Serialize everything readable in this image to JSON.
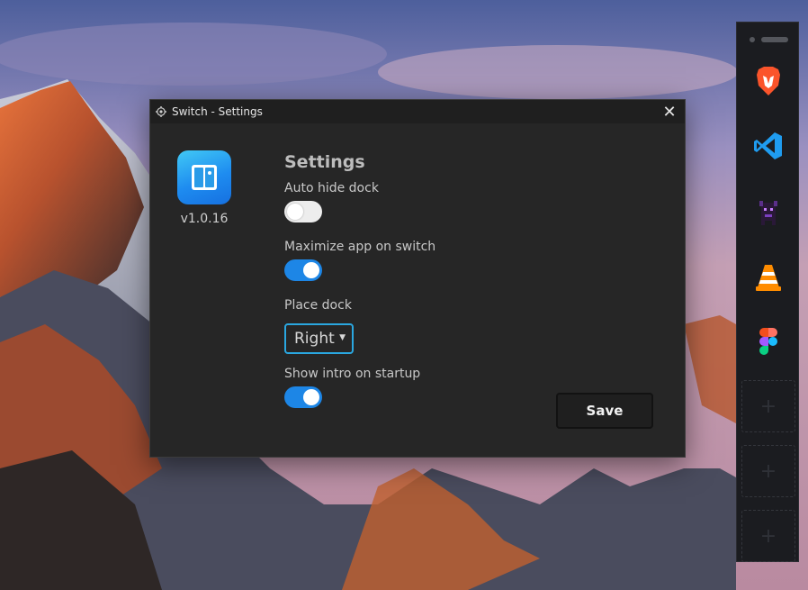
{
  "window": {
    "title": "Switch - Settings",
    "close_glyph": "✕",
    "version": "v1.0.16"
  },
  "settings": {
    "heading": "Settings",
    "auto_hide_dock": {
      "label": "Auto hide dock",
      "enabled": false
    },
    "maximize_app": {
      "label": "Maximize app on switch",
      "enabled": true
    },
    "place_dock": {
      "label": "Place dock",
      "value": "Right",
      "caret": "▼"
    },
    "show_intro": {
      "label": "Show intro on startup",
      "enabled": true
    },
    "save_label": "Save"
  },
  "dock": {
    "apps": [
      {
        "name": "brave-icon"
      },
      {
        "name": "vscode-icon"
      },
      {
        "name": "pixel-creature-icon"
      },
      {
        "name": "vlc-icon"
      },
      {
        "name": "figma-icon"
      }
    ],
    "empty_slot_glyph": "+"
  },
  "colors": {
    "accent": "#1d86e6",
    "select_border": "#2aa7e0",
    "window_bg": "#262626"
  }
}
